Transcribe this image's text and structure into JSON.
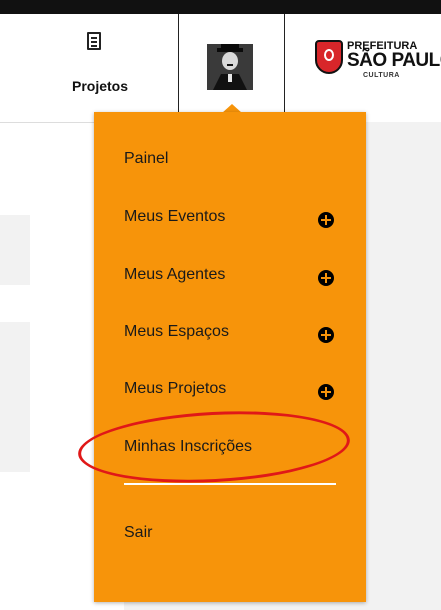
{
  "header": {
    "projects_label": "Projetos",
    "projects_icon": "document-icon",
    "logo": {
      "line1": "PREFEITURA",
      "line2": "SÃO PAULO",
      "line3": "CULTURA"
    }
  },
  "menu": {
    "background_color": "#f7940a",
    "items": [
      {
        "label": "Painel",
        "has_add": false
      },
      {
        "label": "Meus Eventos",
        "has_add": true
      },
      {
        "label": "Meus Agentes",
        "has_add": true
      },
      {
        "label": "Meus Espaços",
        "has_add": true
      },
      {
        "label": "Meus Projetos",
        "has_add": true
      },
      {
        "label": "Minhas Inscrições",
        "has_add": false
      }
    ],
    "logout_label": "Sair"
  },
  "annotation": {
    "highlight_color": "#e01818"
  }
}
